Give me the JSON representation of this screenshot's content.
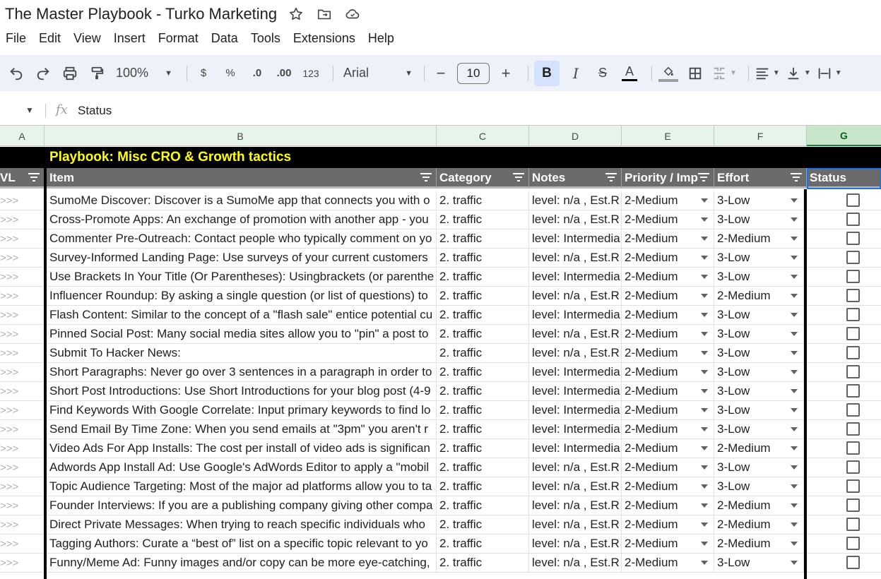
{
  "doc": {
    "title": "The Master Playbook - Turko Marketing"
  },
  "menu": [
    "File",
    "Edit",
    "View",
    "Insert",
    "Format",
    "Data",
    "Tools",
    "Extensions",
    "Help"
  ],
  "toolbar": {
    "zoom": "100%",
    "currency": "$",
    "percent": "%",
    "decrease_decimal": ".0",
    "increase_decimal": ".00",
    "number_format": "123",
    "font": "Arial",
    "font_size": "10",
    "bold": "B",
    "italic": "I",
    "text_color": "A"
  },
  "formula": {
    "fx": "fx",
    "value": "Status"
  },
  "columns": [
    "A",
    "B",
    "C",
    "D",
    "E",
    "F",
    "G"
  ],
  "banner": "Playbook: Misc CRO & Growth tactics",
  "headers": {
    "lvl": "VL",
    "item": "Item",
    "category": "Category",
    "notes": "Notes",
    "priority": "Priority / Imp",
    "effort": "Effort",
    "status": "Status"
  },
  "rows": [
    {
      "lvl": ">>>",
      "item": "SumoMe Discover: Discover is a SumoMe app that connects you with o",
      "category": "2. traffic",
      "notes": "level: n/a , Est.R",
      "priority": "2-Medium",
      "effort": "3-Low"
    },
    {
      "lvl": ">>>",
      "item": "Cross-Promote Apps: An exchange of promotion with another app - you",
      "category": "2. traffic",
      "notes": "level: n/a , Est.R",
      "priority": "2-Medium",
      "effort": "3-Low"
    },
    {
      "lvl": ">>>",
      "item": "Commenter Pre-Outreach: Contact people who typically comment on yo",
      "category": "2. traffic",
      "notes": "level: Intermedia",
      "priority": "2-Medium",
      "effort": "2-Medium"
    },
    {
      "lvl": ">>>",
      "item": "Survey-Informed Landing Page: Use surveys of your current customers",
      "category": "2. traffic",
      "notes": "level: n/a , Est.R",
      "priority": "2-Medium",
      "effort": "3-Low"
    },
    {
      "lvl": ">>>",
      "item": "Use Brackets In Your Title (Or Parentheses): Usingbrackets (or parenthe",
      "category": "2. traffic",
      "notes": "level: Intermedia",
      "priority": "2-Medium",
      "effort": "3-Low"
    },
    {
      "lvl": ">>>",
      "item": "Influencer Roundup: By asking a single question (or list of questions) to",
      "category": "2. traffic",
      "notes": "level: n/a , Est.R",
      "priority": "2-Medium",
      "effort": "2-Medium"
    },
    {
      "lvl": ">>>",
      "item": "Flash Content: Similar to the concept of a \"flash sale\" entice potential cu",
      "category": "2. traffic",
      "notes": "level: Intermedia",
      "priority": "2-Medium",
      "effort": "3-Low"
    },
    {
      "lvl": ">>>",
      "item": "Pinned Social Post: Many social media sites allow you to \"pin\" a post to",
      "category": "2. traffic",
      "notes": "level: n/a , Est.R",
      "priority": "2-Medium",
      "effort": "3-Low"
    },
    {
      "lvl": ">>>",
      "item": "Submit To Hacker News:",
      "category": "2. traffic",
      "notes": "level: n/a , Est.R",
      "priority": "2-Medium",
      "effort": "3-Low"
    },
    {
      "lvl": ">>>",
      "item": "Short Paragraphs: Never go over 3 sentences in a paragraph in order to",
      "category": "2. traffic",
      "notes": "level: Intermedia",
      "priority": "2-Medium",
      "effort": "3-Low"
    },
    {
      "lvl": ">>>",
      "item": "Short Post Introductions: Use Short Introductions for your blog post (4-9",
      "category": "2. traffic",
      "notes": "level: Intermedia",
      "priority": "2-Medium",
      "effort": "3-Low"
    },
    {
      "lvl": ">>>",
      "item": "Find Keywords With Google Correlate: Input primary keywords to find lo",
      "category": "2. traffic",
      "notes": "level: Intermedia",
      "priority": "2-Medium",
      "effort": "3-Low"
    },
    {
      "lvl": ">>>",
      "item": "Send Email By Time Zone: When you send emails at \"3pm\" you aren't r",
      "category": "2. traffic",
      "notes": "level: Intermedia",
      "priority": "2-Medium",
      "effort": "3-Low"
    },
    {
      "lvl": ">>>",
      "item": "Video Ads For App Installs: The cost per install of video ads is significan",
      "category": "2. traffic",
      "notes": "level: Intermedia",
      "priority": "2-Medium",
      "effort": "2-Medium"
    },
    {
      "lvl": ">>>",
      "item": "Adwords App Install Ad: Use Google's AdWords Editor to apply a \"mobil",
      "category": "2. traffic",
      "notes": "level: n/a , Est.R",
      "priority": "2-Medium",
      "effort": "3-Low"
    },
    {
      "lvl": ">>>",
      "item": "Topic Audience Targeting: Most of the major ad platforms allow you to ta",
      "category": "2. traffic",
      "notes": "level: n/a , Est.R",
      "priority": "2-Medium",
      "effort": "3-Low"
    },
    {
      "lvl": ">>>",
      "item": "Founder Interviews: If you are a publishing company giving other compa",
      "category": "2. traffic",
      "notes": "level: n/a , Est.R",
      "priority": "2-Medium",
      "effort": "2-Medium"
    },
    {
      "lvl": ">>>",
      "item": "Direct Private Messages: When trying to reach specific individuals who",
      "category": "2. traffic",
      "notes": "level: n/a , Est.R",
      "priority": "2-Medium",
      "effort": "2-Medium"
    },
    {
      "lvl": ">>>",
      "item": "Tagging Authors: Curate a “best of” list on a specific topic relevant to yo",
      "category": "2. traffic",
      "notes": "level: n/a , Est.R",
      "priority": "2-Medium",
      "effort": "2-Medium"
    },
    {
      "lvl": ">>>",
      "item": "Funny/Meme Ad: Funny images and/or copy can be more eye-catching,",
      "category": "2. traffic",
      "notes": "level: n/a , Est.R",
      "priority": "2-Medium",
      "effort": "3-Low"
    }
  ]
}
